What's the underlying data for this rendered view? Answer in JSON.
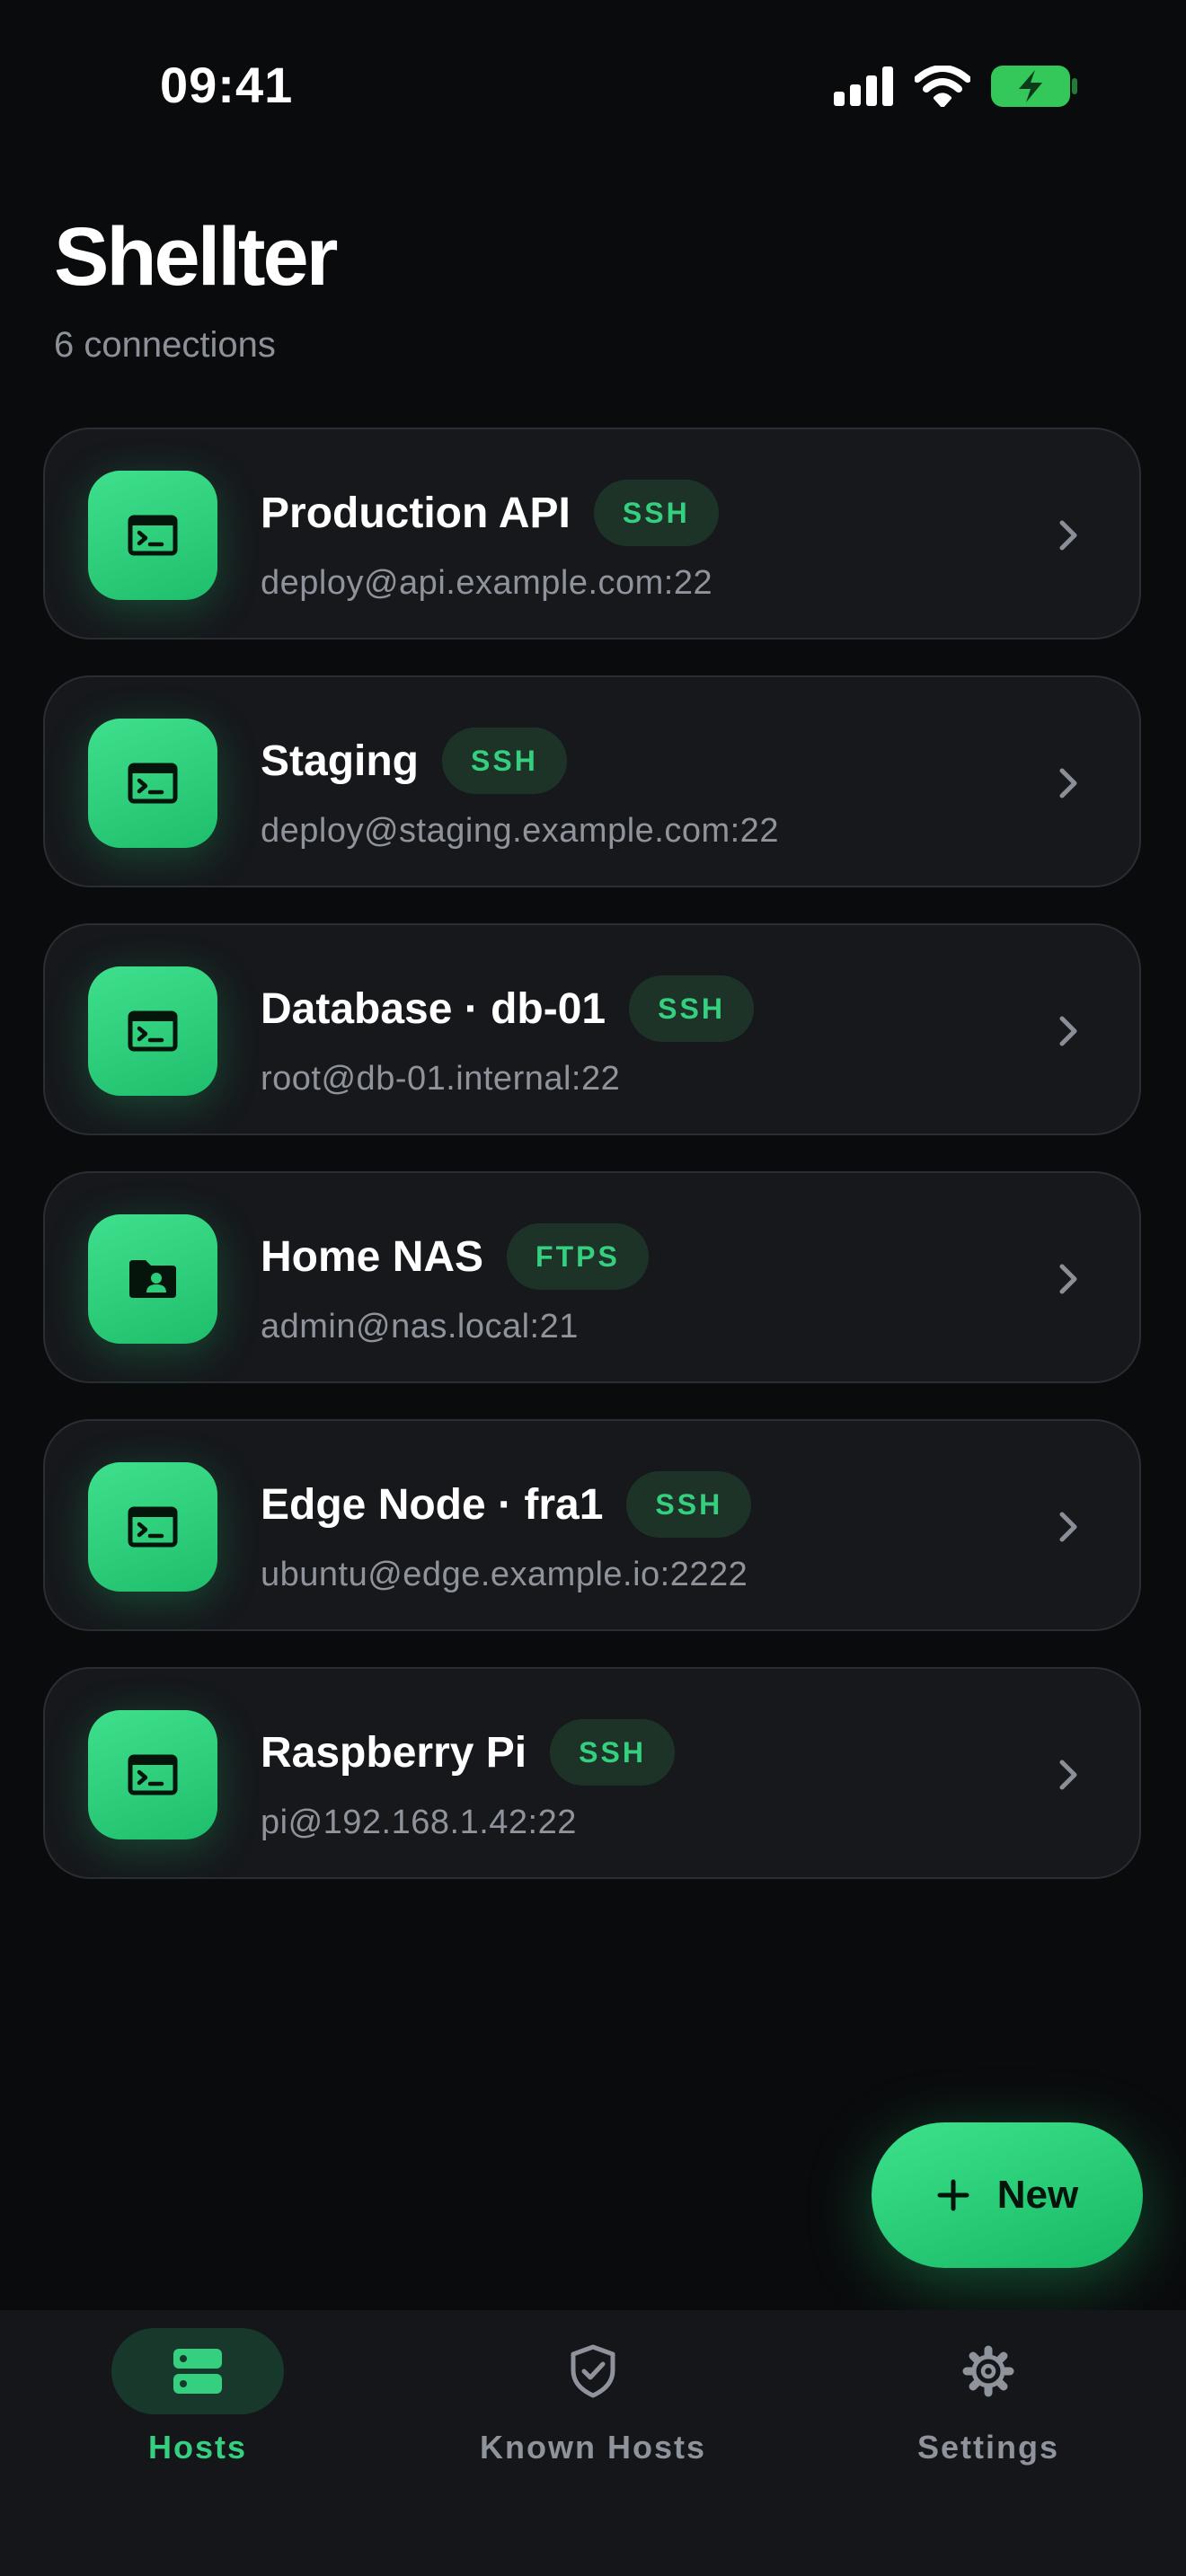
{
  "status_bar": {
    "time": "09:41"
  },
  "header": {
    "title": "Shellter",
    "subtitle": "6 connections"
  },
  "colors": {
    "accent": "#35d07f",
    "background": "#0a0b0d",
    "card": "#16181c"
  },
  "hosts": [
    {
      "name": "Production API",
      "protocol": "SSH",
      "address": "deploy@api.example.com:22",
      "icon": "terminal-icon"
    },
    {
      "name": "Staging",
      "protocol": "SSH",
      "address": "deploy@staging.example.com:22",
      "icon": "terminal-icon"
    },
    {
      "name": "Database · db-01",
      "protocol": "SSH",
      "address": "root@db-01.internal:22",
      "icon": "terminal-icon"
    },
    {
      "name": "Home NAS",
      "protocol": "FTPS",
      "address": "admin@nas.local:21",
      "icon": "folder-user-icon"
    },
    {
      "name": "Edge Node · fra1",
      "protocol": "SSH",
      "address": "ubuntu@edge.example.io:2222",
      "icon": "terminal-icon"
    },
    {
      "name": "Raspberry Pi",
      "protocol": "SSH",
      "address": "pi@192.168.1.42:22",
      "icon": "terminal-icon"
    }
  ],
  "fab": {
    "label": "New",
    "icon": "plus-icon"
  },
  "tabs": [
    {
      "label": "Hosts",
      "icon": "server-icon",
      "active": true
    },
    {
      "label": "Known Hosts",
      "icon": "shield-check-icon",
      "active": false
    },
    {
      "label": "Settings",
      "icon": "gear-icon",
      "active": false
    }
  ]
}
